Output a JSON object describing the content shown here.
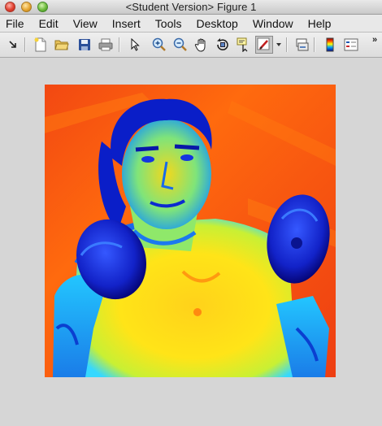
{
  "window": {
    "title": "<Student Version> Figure 1"
  },
  "menu": {
    "items": [
      "File",
      "Edit",
      "View",
      "Insert",
      "Tools",
      "Desktop",
      "Window",
      "Help"
    ]
  },
  "toolbar": {
    "buttons": [
      "dock-arrow-icon",
      "new-figure-icon",
      "open-file-icon",
      "save-icon",
      "print-icon",
      "select-arrow-icon",
      "zoom-in-icon",
      "zoom-out-icon",
      "pan-hand-icon",
      "rotate-3d-icon",
      "data-cursor-icon",
      "brush-icon",
      "link-plot-icon",
      "colorbar-icon",
      "legend-icon"
    ],
    "overflow": "»"
  },
  "figure": {
    "image_description": "jet-colormapped photo (boxer portrait)",
    "colormap": [
      "#00007f",
      "#0000ff",
      "#00ffff",
      "#ffff00",
      "#ff0000",
      "#7f0000"
    ]
  }
}
